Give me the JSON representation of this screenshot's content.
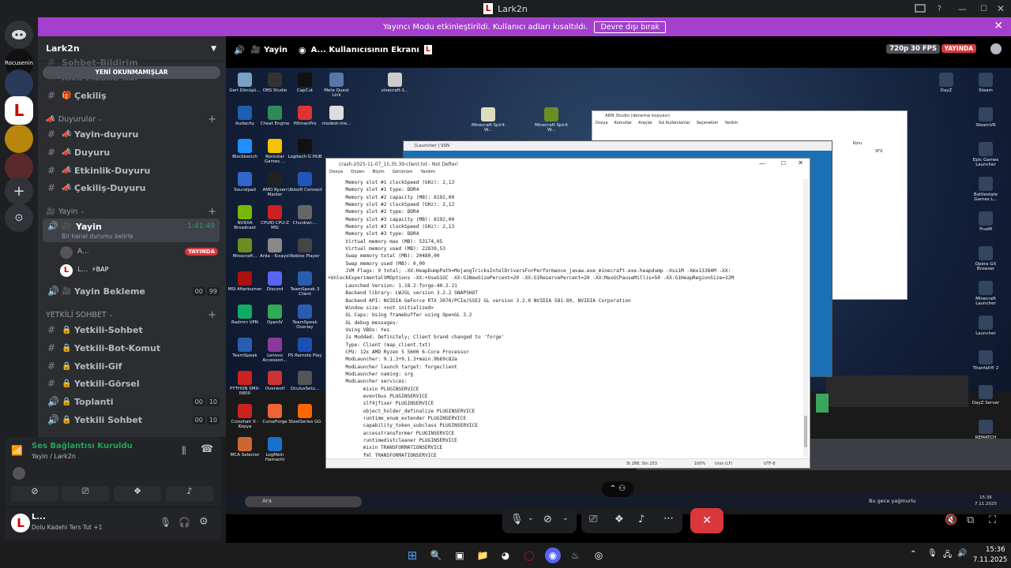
{
  "window": {
    "title": "Lark2n",
    "logo": "L"
  },
  "banner": {
    "text": "Yayıncı Modu etkinleştirildi. Kullanıcı adları kısaltıldı.",
    "button": "Devre dışı bırak"
  },
  "rail": {
    "server1_label": "Rocusenin"
  },
  "server": {
    "name": "Lark2n",
    "new_unreads": "YENİ OKUNMAMIŞLAR"
  },
  "channels": {
    "top_faded": [
      "Sohbet-Bildirim",
      "Kick-Mobile-Kor"
    ],
    "cekilis": "Çekiliş",
    "cat_duyurular": "Duyurular",
    "duyurular": [
      "Yayin-duyuru",
      "Duyuru",
      "Etkinlik-Duyuru",
      "Çekiliş-Duyuru"
    ],
    "cat_yayin": "Yayin",
    "yayin_channel": "Yayin",
    "yayin_timer": "1:41:49",
    "yayin_status": "Bir kanal durumu belirle",
    "yayin_users": [
      {
        "name": "A...",
        "badge": "YAYINDA"
      },
      {
        "name": "L...",
        "tag": "⚡BAP"
      }
    ],
    "yayin_bekleme": "Yayin Bekleme",
    "yayin_bekleme_counts": [
      "00",
      "99"
    ],
    "cat_yetkili": "YETKİLİ SOHBET",
    "yetkili": [
      "Yetkili-Sohbet",
      "Yetkili-Bot-Komut",
      "Yetkili-Gif",
      "Yetkili-Görsel"
    ],
    "toplanti": "Toplanti",
    "toplanti_counts": [
      "00",
      "10"
    ],
    "yetkili_sohbet2": "Yetkili Sohbet",
    "yetkili_sohbet2_counts": [
      "00",
      "10"
    ]
  },
  "voice": {
    "status": "Ses Bağlantısı Kuruldu",
    "channel": "Yayin / Lark2n"
  },
  "user": {
    "name": "L...",
    "status": "Dolu Kadehi Ters Tut +1"
  },
  "stage": {
    "channel": "Yayin",
    "screen_title": "A... Kullanıcısının Ekranı",
    "quality": "720p 30 FPS",
    "live": "YAYINDA"
  },
  "desktop_icons": [
    {
      "label": "Geri Dönüşü...",
      "color": "#7aa0c4"
    },
    {
      "label": "OBS Studio",
      "color": "#333"
    },
    {
      "label": "CapCut",
      "color": "#111"
    },
    {
      "label": "Meta Quest Link",
      "color": "#5577aa"
    },
    {
      "label": "vivecraft-1...",
      "color": "#ccc"
    },
    {
      "label": "Audacity",
      "color": "#1d5fb0"
    },
    {
      "label": "Cheat Engine",
      "color": "#2e8b57"
    },
    {
      "label": "HitmanPro",
      "color": "#d33"
    },
    {
      "label": "modest-me...",
      "color": "#ddd"
    },
    {
      "label": "Blockbench",
      "color": "#1e90ff"
    },
    {
      "label": "Rockstar Games ...",
      "color": "#f5c400"
    },
    {
      "label": "Logitech G HUB",
      "color": "#111"
    },
    {
      "label": "Soundpad",
      "color": "#3366cc"
    },
    {
      "label": "AMD Ryzen Master",
      "color": "#222"
    },
    {
      "label": "Ubisoft Connect",
      "color": "#2255bb"
    },
    {
      "label": "NVIDIA Broadcast",
      "color": "#76b900"
    },
    {
      "label": "CPUID CPU-Z MSI",
      "color": "#cc2222"
    },
    {
      "label": "Chunkwi-...",
      "color": "#666"
    },
    {
      "label": "Minecraft...",
      "color": "#6b8e23"
    },
    {
      "label": "Arda - Kısayol",
      "color": "#888"
    },
    {
      "label": "Roblox Player",
      "color": "#444"
    },
    {
      "label": "MSI Afterburner",
      "color": "#aa1111"
    },
    {
      "label": "Discord",
      "color": "#5865f2"
    },
    {
      "label": "TeamSpeak 3 Client",
      "color": "#2a5db0"
    },
    {
      "label": "Radmin VPN",
      "color": "#1a6"
    },
    {
      "label": "OpenIV",
      "color": "#3a5"
    },
    {
      "label": "TeamSpeak Overlay",
      "color": "#2a5db0"
    },
    {
      "label": "TeamSpeak",
      "color": "#2a5db0"
    },
    {
      "label": "Lenovo Accessori...",
      "color": "#8a3a9a"
    },
    {
      "label": "PS Remote Play",
      "color": "#1b4fb4"
    },
    {
      "label": "PYTHON SMX-R800",
      "color": "#c22"
    },
    {
      "label": "Overwolf",
      "color": "#c33"
    },
    {
      "label": "OculusSetu...",
      "color": "#555"
    },
    {
      "label": "Crosshair X - Kopya",
      "color": "#c22"
    },
    {
      "label": "CurseForge",
      "color": "#f16436"
    },
    {
      "label": "SteelSeries GG",
      "color": "#f60"
    },
    {
      "label": "MCA Selector",
      "color": "#c63"
    },
    {
      "label": "LogMeIn Hamachi",
      "color": "#1b6fd0"
    }
  ],
  "right_icons": [
    "DayZ",
    "Steam",
    "SteamVR",
    "Epic Games Launcher",
    "Battlestate Games L...",
    "FiveM",
    "Opera GX Browser",
    "Minecraft Launcher",
    "Launcher",
    "Titanfall® 2",
    "DayZ Server",
    "REMATCH"
  ],
  "center_icons": [
    "Minecraft Spirit W...",
    "Minecraft Spirit W..."
  ],
  "launcher_title": "[Launcher | SSN",
  "notepad": {
    "title": "crash-2025-11-07_15.35.39-client.txt - Not Defteri",
    "menu": [
      "Dosya",
      "Düzen",
      "Biçim",
      "Görünüm",
      "Yardım"
    ],
    "lines": [
      "      Memory slot #1 clockSpeed (GHz): 2,13",
      "      Memory slot #1 type: DDR4",
      "      Memory slot #2 capacity (MB): 8192,00",
      "      Memory slot #2 clockSpeed (GHz): 2,13",
      "      Memory slot #2 type: DDR4",
      "      Memory slot #3 capacity (MB): 8192,00",
      "      Memory slot #3 clockSpeed (GHz): 2,13",
      "      Memory slot #3 type: DDR4",
      "      Virtual memory max (MB): 53174,05",
      "      Virtual memory used (MB): 22839,53",
      "      Swap memory total (MB): 20480,00",
      "      Swap memory used (MB): 0,00",
      "      JVM Flags: 9 total; -XX:HeapDumpPath=MojangTricksIntelDriversForPerformance_javaw.exe_minecraft.exe.heapdump -Xss1M -Xmx13384M -XX:",
      "+UnlockExperimentalVMOptions -XX:+UseG1GC -XX:G1NewSizePercent=20 -XX:G1ReservePercent=20 -XX:MaxGCPauseMillis=50 -XX:G1HeapRegionSize=32M",
      "      Launched Version: 1.18.2-forge-40.2.21",
      "      Backend library: LWJGL version 3.2.2 SNAPSHOT",
      "      Backend API: NVIDIA GeForce RTX 3070/PCIe/SSE2 GL version 3.2.0 NVIDIA 581.80, NVIDIA Corporation",
      "      Window size: <not initialized>",
      "      GL Caps: Using framebuffer using OpenGL 3.2",
      "      GL debug messages:",
      "      Using VBOs: Yes",
      "      Is Modded: Definitely; Client brand changed to 'forge'",
      "      Type: Client (map_client.txt)",
      "      CPU: 12x AMD Ryzen 5 5600 6-Core Processor",
      "      ModLauncher: 9.1.3+9.1.3+main.9b69c82a",
      "      ModLauncher launch target: forgeclient",
      "      ModLauncher naming: srg",
      "      ModLauncher services:",
      "            mixin PLUGINSERVICE",
      "            eventbus PLUGINSERVICE",
      "            slf4jfixer PLUGINSERVICE",
      "            object_holder_definalize PLUGINSERVICE",
      "            runtime_enum_extender PLUGINSERVICE",
      "            capability_token_subclass PLUGINSERVICE",
      "            accesstransformer PLUGINSERVICE",
      "            runtimedistcleaner PLUGINSERVICE",
      "            mixin TRANSFORMATIONSERVICE",
      "            fml TRANSFORMATIONSERVICE"
    ],
    "status": {
      "pos": "St 288, Stn 253",
      "zoom": "100%",
      "eol": "Unix (LF)",
      "enc": "UTF-8"
    }
  },
  "editor_window": {
    "title": "ABN Studio (deneme kopyası)",
    "menu": [
      "Dosya",
      "Komutlar",
      "Araçlar",
      "Sık Kullanılanlar",
      "Seçenekler",
      "Yardım"
    ],
    "labels": [
      "Koru",
      "SFX"
    ]
  },
  "inner_taskbar": {
    "search": "Ara",
    "weather": "Bu gece yağmurlu",
    "time": "15:36",
    "date": "7.11.2025"
  },
  "taskbar": {
    "time": "15:36",
    "date": "7.11.2025"
  }
}
